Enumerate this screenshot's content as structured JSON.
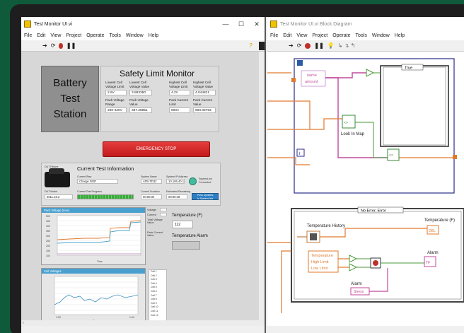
{
  "left_window": {
    "title": "Test Monitor UI.vi",
    "menu": [
      "File",
      "Edit",
      "View",
      "Project",
      "Operate",
      "Tools",
      "Window",
      "Help"
    ],
    "window_controls": [
      "—",
      "☐",
      "✕"
    ],
    "panel": {
      "battery_label_lines": [
        "Battery",
        "Test",
        "Station"
      ],
      "safety": {
        "title": "Safety Limit Monitor",
        "headers": [
          [
            "Lowest Cell",
            "Voltage Limit"
          ],
          [
            "Lowest Cell",
            "Voltage Value"
          ],
          [
            "Highest Cell",
            "Voltage Limit"
          ],
          [
            "Highest Cell",
            "Voltage Value"
          ]
        ],
        "values_row1": [
          "2.6V",
          "3.883350",
          "4.2V",
          "4.044821"
        ],
        "headers2": [
          [
            "Pack Voltage",
            "Range"
          ],
          [
            "Pack Voltage",
            "Value"
          ],
          [
            "Pack Current",
            "Limit"
          ],
          [
            "Pack Current",
            "Value"
          ]
        ],
        "values_row2": [
          "250-420V",
          "387.28851",
          "600A",
          "600.05753"
        ],
        "emergency_label": "EMERGENCY STOP"
      },
      "info": {
        "title": "Current Test Information",
        "device_name_label": "DUT Picture",
        "current_step_label": "Current Step",
        "current_step_value": "Charge DOP",
        "system_name_label": "System Name",
        "system_name_value": "ATB-TD32",
        "system_ip_label": "System IP Address",
        "system_ip_value": "10.106.40.1",
        "dut_model_label": "DUT Model",
        "dut_model_value": "2011.23.2",
        "progress_label": "Current Test Progress",
        "elapsed_label": "Current Duration",
        "elapsed_value": "00:00:34",
        "remaining_label": "Estimated Remaining",
        "remaining_value": "00:00:48",
        "link_status": [
          "SystemLink",
          "Connected"
        ],
        "link_button": [
          "Push Updates",
          "to SystemLink"
        ],
        "progress_fraction": 0.8
      },
      "chart1": {
        "title": "Pack Voltage (Live)",
        "xlabel": "Time",
        "yticks": [
          "500",
          "450",
          "400",
          "350",
          "300",
          "250",
          "200",
          "150",
          "100"
        ],
        "side_labels": [
          "Voltage",
          "Current"
        ],
        "side_info": [
          "Total Voltage",
          "Value",
          "Pack Current",
          "Value"
        ],
        "series_colors": [
          "#e07a2e",
          "#4aa3c9"
        ]
      },
      "chart2": {
        "title": "Cell Voltages",
        "xlabel": "Time",
        "xticks": [
          "1:00",
          "1:44"
        ],
        "legend": [
          "Cell 1",
          "Cell 2",
          "Cell 3",
          "Cell 4",
          "Cell 5",
          "Cell 6",
          "Cell 7",
          "Cell 8",
          "Cell 9",
          "Cell 10",
          "Cell 11",
          "Cell 12"
        ]
      },
      "temperature_label": "Temperature (F)",
      "temperature_value": "112",
      "temperature_alarm_label": "Temperature Alarm"
    }
  },
  "right_window": {
    "title": "Test Monitor UI.vi Block Diagram",
    "menu": [
      "File",
      "Edit",
      "View",
      "Project",
      "Operate",
      "Tools",
      "Window",
      "Help"
    ],
    "diagram": {
      "case_true": "True",
      "case_error": "No Error, Error",
      "bundle_items": [
        "name",
        "amount"
      ],
      "lookup_label": "Look In Map",
      "temp_history": "Temperature History",
      "temp_terminal": "Temperature (F)",
      "bundle2_items": [
        "Temperature",
        "High Limit",
        "Low Limit"
      ],
      "alarm_label": "Alarm",
      "alarm_item": "Stress",
      "alarm_indicator_label": "Alarm",
      "info_icon": "i"
    }
  },
  "icons": [
    "run-arrow-icon",
    "run-continuous-icon",
    "abort-icon",
    "pause-icon",
    "help-icon"
  ]
}
